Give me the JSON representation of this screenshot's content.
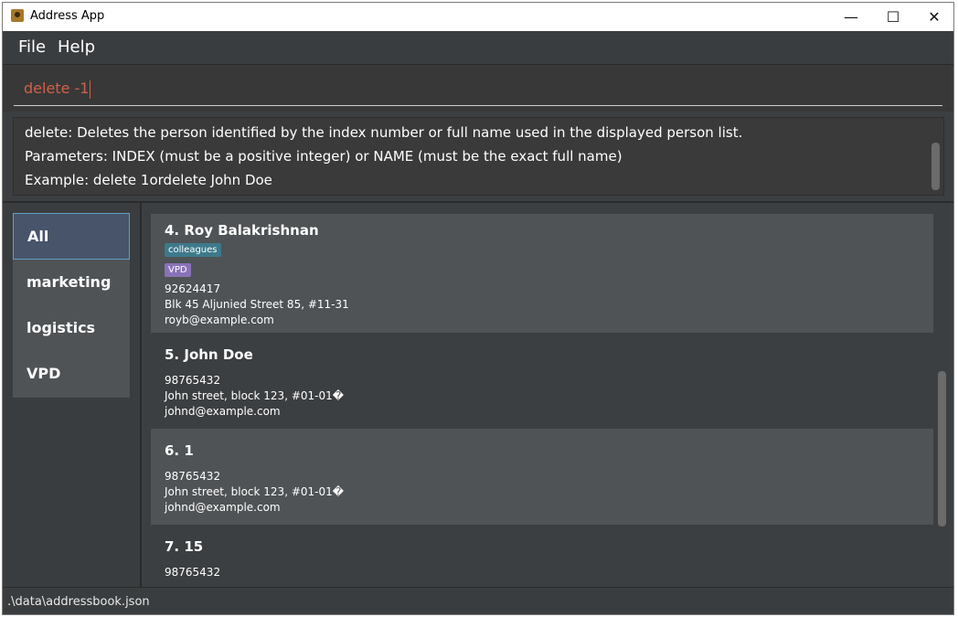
{
  "window": {
    "title": "Address App",
    "controls": {
      "minimize": "—",
      "maximize": "☐",
      "close": "✕"
    }
  },
  "menu": {
    "items": [
      "File",
      "Help"
    ]
  },
  "command": {
    "value": "delete -1"
  },
  "result": {
    "lines": [
      "delete: Deletes the person identified by the index number or full name used in the displayed person list.",
      "Parameters: INDEX (must be a positive integer) or NAME (must be the exact full name)",
      "Example: delete 1ordelete John Doe"
    ]
  },
  "tags": {
    "items": [
      "All",
      "marketing",
      "logistics",
      "VPD"
    ],
    "selected": "All"
  },
  "persons": [
    {
      "header": "4.  Roy Balakrishnan",
      "tags": [
        {
          "label": "colleagues",
          "color": "#3d7a8a"
        },
        {
          "label": "VPD",
          "color": "#8a72b8"
        }
      ],
      "phone": "92624417",
      "address": "Blk 45 Aljunied Street 85, #11-31",
      "email": "royb@example.com"
    },
    {
      "header": "5.  John Doe",
      "tags": [],
      "phone": "98765432",
      "address": "John street, block 123, #01-01�",
      "email": "johnd@example.com"
    },
    {
      "header": "6.  1",
      "tags": [],
      "phone": "98765432",
      "address": "John street, block 123, #01-01�",
      "email": "johnd@example.com"
    },
    {
      "header": "7.  15",
      "tags": [],
      "phone": "98765432",
      "address": "",
      "email": ""
    }
  ],
  "status": {
    "path": ".\\data\\addressbook.json"
  },
  "colors": {
    "card_odd": "#4f5356",
    "card_even": "#3c3f41",
    "command_text": "#d0604a"
  }
}
